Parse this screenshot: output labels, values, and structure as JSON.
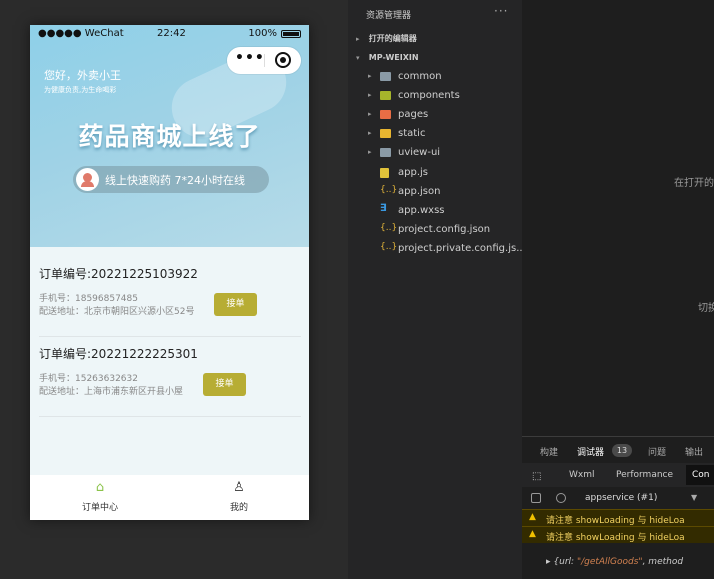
{
  "simulator": {
    "status": {
      "signal": "●●●●● WeChat",
      "time": "22:42",
      "battery": "100%"
    },
    "greeting": "您好，外卖小王",
    "slogan": "为健康负责,为生命喝彩",
    "headline": "药品商城上线了",
    "pill_text": "线上快速购药  7*24小时在线",
    "orders": [
      {
        "number": "订单编号:20221225103922",
        "phone": "手机号：18596857485",
        "address": "配送地址：北京市朝阳区兴源小区52号",
        "button": "接单"
      },
      {
        "number": "订单编号:20221222225301",
        "phone": "手机号：15263632632",
        "address": "配送地址：上海市浦东新区开县小屋",
        "button": "接单"
      }
    ],
    "tabs": [
      {
        "label": "订单中心",
        "icon": "home-icon"
      },
      {
        "label": "我的",
        "icon": "user-icon"
      }
    ]
  },
  "explorer": {
    "title": "资源管理器",
    "more": "···",
    "open_editors": "打开的编辑器",
    "project": "MP-WEIXIN",
    "items": [
      {
        "label": "common",
        "type": "folder"
      },
      {
        "label": "components",
        "type": "folder"
      },
      {
        "label": "pages",
        "type": "folder"
      },
      {
        "label": "static",
        "type": "folder"
      },
      {
        "label": "uview-ui",
        "type": "folder"
      },
      {
        "label": "app.js",
        "type": "js"
      },
      {
        "label": "app.json",
        "type": "json"
      },
      {
        "label": "app.wxss",
        "type": "css"
      },
      {
        "label": "project.config.json",
        "type": "json"
      },
      {
        "label": "project.private.config.js...",
        "type": "json"
      }
    ]
  },
  "editor": {
    "hint1": "在打开的",
    "hint2": "切换"
  },
  "debug": {
    "tabs": [
      "构建",
      "调试器",
      "问题",
      "输出"
    ],
    "badge": "13",
    "subtabs": [
      "Wxml",
      "Performance",
      "Con"
    ],
    "context": "appservice (#1)",
    "warnings": [
      "请注意 showLoading 与 hideLoa",
      "请注意 showLoading 与 hideLoa"
    ],
    "log_prefix": "{url: ",
    "log_url": "\"/getAllGoods\"",
    "log_suffix": ", method"
  }
}
